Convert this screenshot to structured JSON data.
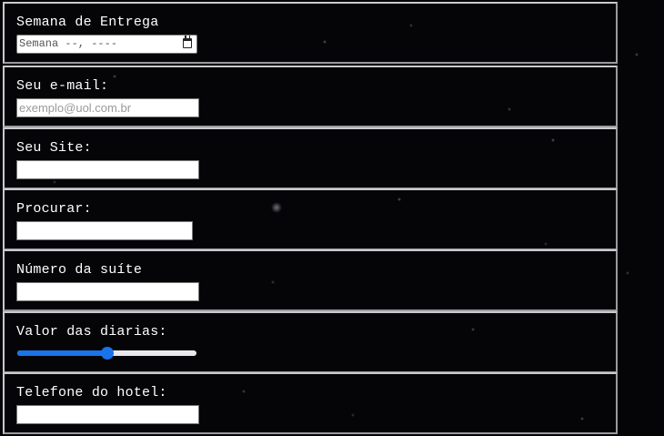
{
  "form": {
    "fields": [
      {
        "label": "Semana de Entrega",
        "type": "week",
        "display": "Semana --, ----"
      },
      {
        "label": "Seu e-mail:",
        "type": "email",
        "value": "",
        "placeholder": "exemplo@uol.com.br"
      },
      {
        "label": "Seu Site:",
        "type": "url",
        "value": "",
        "placeholder": ""
      },
      {
        "label": "Procurar:",
        "type": "search",
        "value": "",
        "placeholder": ""
      },
      {
        "label": "Número da suíte",
        "type": "number",
        "value": "",
        "placeholder": ""
      },
      {
        "label": "Valor das diarias:",
        "type": "range",
        "fraction": 0.5
      },
      {
        "label": "Telefone do hotel:",
        "type": "tel",
        "value": "",
        "placeholder": ""
      }
    ]
  },
  "icons": {
    "calendar": "calendar-icon"
  },
  "colors": {
    "background": "#050508",
    "border": "#9a9a9f",
    "accent": "#1a73e8",
    "label": "#ffffff"
  }
}
